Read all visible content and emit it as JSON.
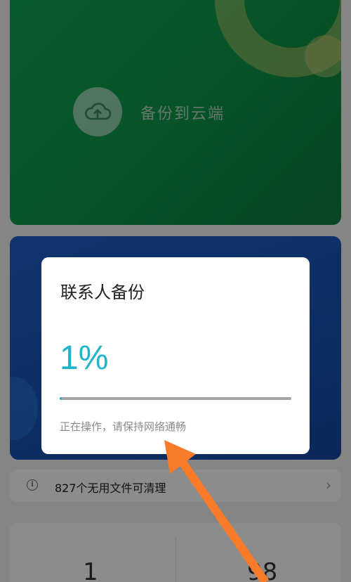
{
  "backup_card": {
    "label": "备份到云端",
    "icon": "cloud-upload-icon"
  },
  "dialog": {
    "title": "联系人备份",
    "percent_text": "1%",
    "progress": 0.01,
    "hint": "正在操作，请保持网络通畅"
  },
  "info_strip": {
    "icon": "info-icon",
    "text": "827个无用文件可清理",
    "chevron": "chevron-right-icon"
  },
  "stats": {
    "left_value": "1",
    "right_value": "98"
  },
  "colors": {
    "accent": "#1fb3cc",
    "green_card": "#0f9a4a",
    "blue_card": "#1953b5",
    "arrow": "#f97a28"
  }
}
